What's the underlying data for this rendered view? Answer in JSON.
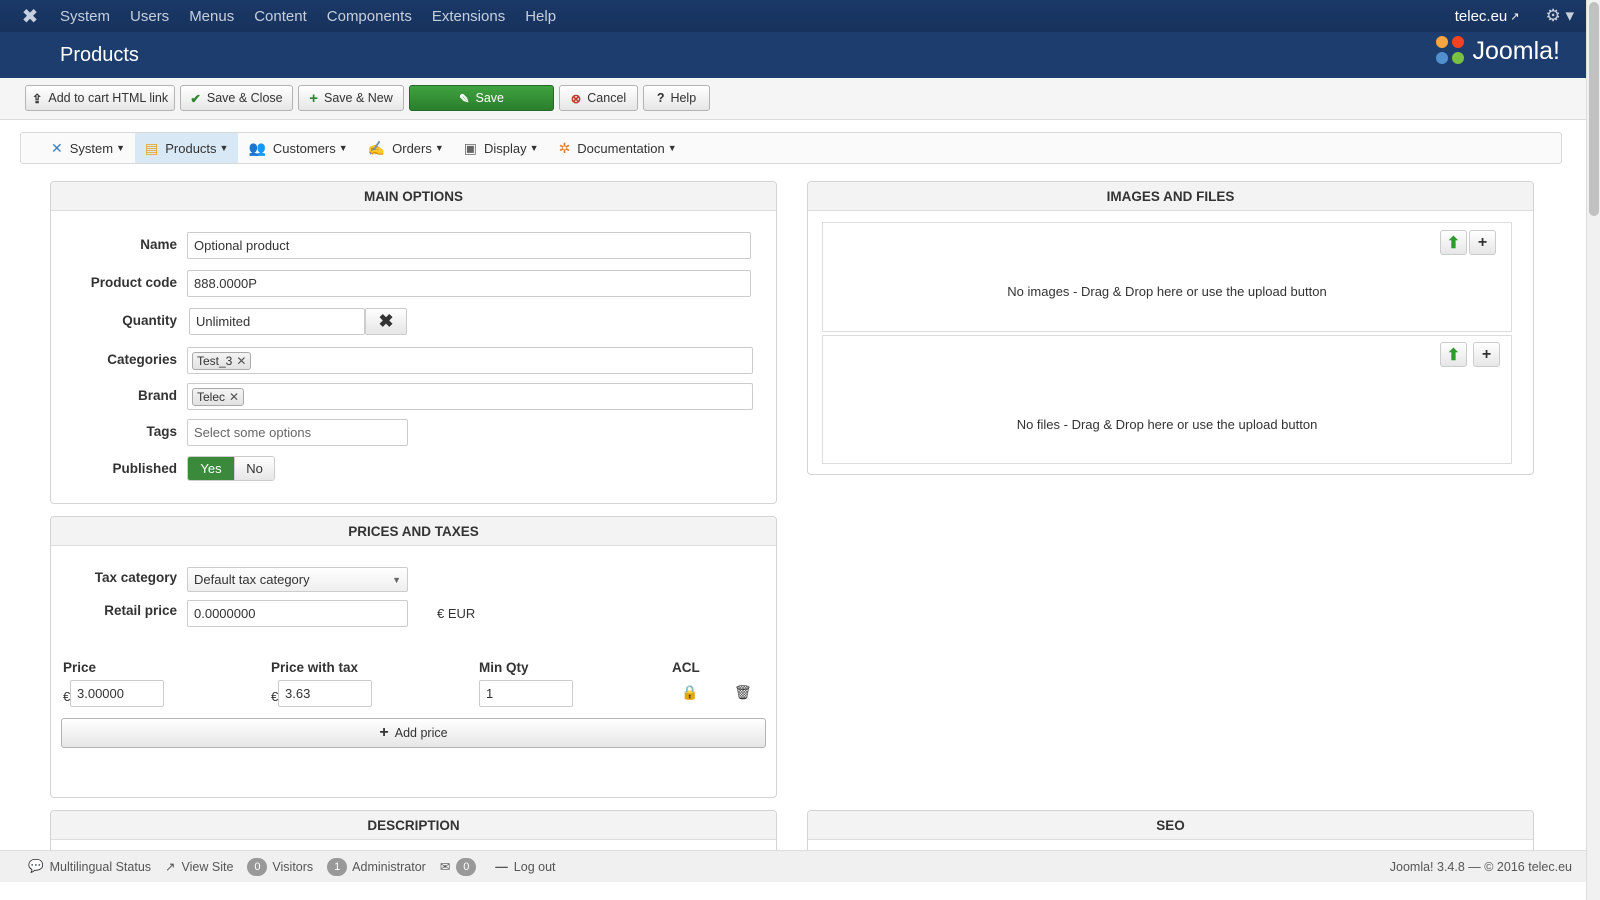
{
  "topnav": {
    "logo_icon": "joomla-x-icon",
    "menu": [
      "System",
      "Users",
      "Menus",
      "Content",
      "Components",
      "Extensions",
      "Help"
    ],
    "site_link": "telec.eu",
    "gear_icon": "gear-icon"
  },
  "header": {
    "title": "Products",
    "brand": "Joomla!"
  },
  "toolbar": {
    "add_to_cart": "Add to cart HTML link",
    "save_close": "Save & Close",
    "save_new": "Save & New",
    "save": "Save",
    "cancel": "Cancel",
    "help": "Help"
  },
  "submenu": [
    {
      "label": "System",
      "icon": "wrench-icon"
    },
    {
      "label": "Products",
      "icon": "box-icon",
      "active": true
    },
    {
      "label": "Customers",
      "icon": "users-icon"
    },
    {
      "label": "Orders",
      "icon": "orders-icon"
    },
    {
      "label": "Display",
      "icon": "display-icon"
    },
    {
      "label": "Documentation",
      "icon": "documentation-icon"
    }
  ],
  "main_options": {
    "title": "MAIN OPTIONS",
    "name_label": "Name",
    "name_value": "Optional product",
    "code_label": "Product code",
    "code_value": "888.0000P",
    "qty_label": "Quantity",
    "qty_value": "Unlimited",
    "categories_label": "Categories",
    "categories": [
      "Test_3"
    ],
    "brand_label": "Brand",
    "brand": [
      "Telec"
    ],
    "tags_label": "Tags",
    "tags_placeholder": "Select some options",
    "published_label": "Published",
    "yes": "Yes",
    "no": "No"
  },
  "images_files": {
    "title": "IMAGES AND FILES",
    "no_images": "No images - Drag & Drop here or use the upload button",
    "no_files": "No files - Drag & Drop here or use the upload button"
  },
  "prices": {
    "title": "PRICES AND TAXES",
    "tax_label": "Tax category",
    "tax_value": "Default tax category",
    "retail_label": "Retail price",
    "retail_value": "0.0000000",
    "currency": "€ EUR",
    "price_label": "Price",
    "price_tax_label": "Price with tax",
    "minqty_label": "Min Qty",
    "acl_label": "ACL",
    "currency_symbol": "€",
    "price_value": "3.00000",
    "price_tax_value": "3.63",
    "minqty_value": "1",
    "add_price": "Add price"
  },
  "description": {
    "title": "DESCRIPTION"
  },
  "seo": {
    "title": "SEO"
  },
  "footer": {
    "multilingual": "Multilingual Status",
    "view_site": "View Site",
    "visitors_count": "0",
    "visitors": "Visitors",
    "admin_count": "1",
    "admin": "Administrator",
    "messages_count": "0",
    "logout": "Log out",
    "version": "Joomla! 3.4.8 — © 2016 telec.eu"
  }
}
